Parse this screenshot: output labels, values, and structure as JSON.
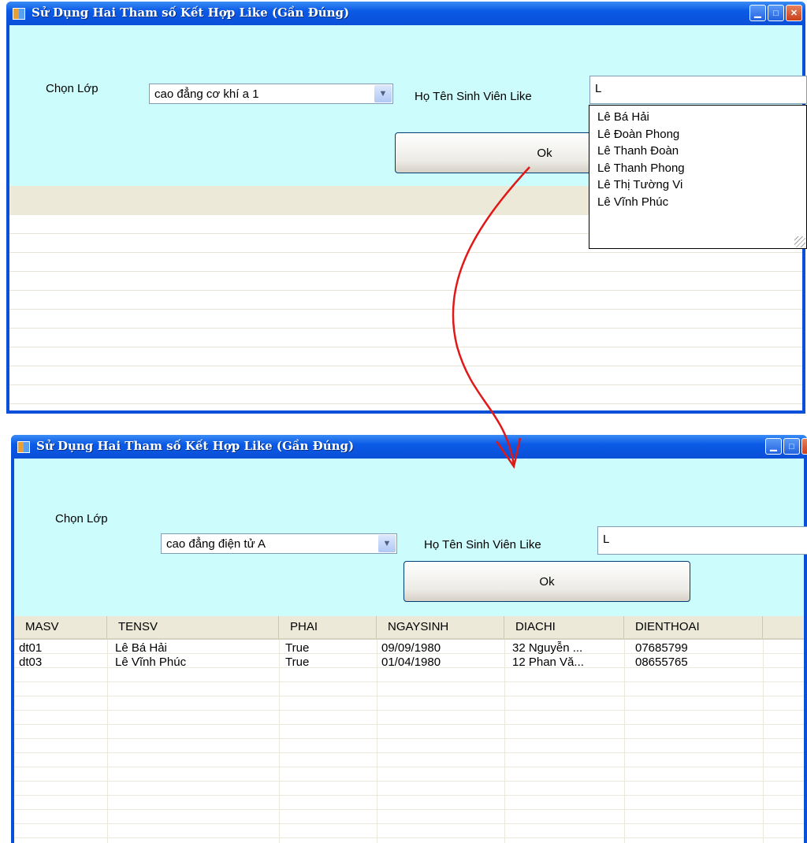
{
  "window1": {
    "title": "Sử Dụng Hai Tham số Kết Hợp Like (Gần Đúng)",
    "class_label": "Chọn Lớp",
    "class_value": "cao đẳng cơ khí a 1",
    "name_label": "Họ Tên Sinh Viên Like",
    "name_value": "L",
    "ok_label": "Ok",
    "suggestions": [
      "Lê Bá Hải",
      "Lê Đoàn Phong",
      "Lê Thanh Đoàn",
      "Lê Thanh Phong",
      "Lê Thị Tường Vi",
      "Lê Vĩnh Phúc"
    ]
  },
  "window2": {
    "title": "Sử Dụng Hai Tham số Kết Hợp Like (Gần Đúng)",
    "class_label": "Chọn Lớp",
    "class_value": "cao đẳng điện tử A",
    "name_label": "Họ Tên Sinh Viên Like",
    "name_value": "L",
    "ok_label": "Ok",
    "columns": [
      "MASV",
      "TENSV",
      "PHAI",
      "NGAYSINH",
      "DIACHI",
      "DIENTHOAI"
    ],
    "rows": [
      [
        "dt01",
        "Lê Bá Hải",
        "True",
        "09/09/1980",
        "32 Nguyễn ...",
        "07685799"
      ],
      [
        "dt03",
        "Lê Vĩnh Phúc",
        "True",
        "01/04/1980",
        "12 Phan Vă...",
        "08655765"
      ]
    ]
  },
  "colors": {
    "titlebar": "#0a4fd8",
    "client_bg": "#ccfcfc",
    "arrow": "#e01818"
  },
  "icons": {
    "window_icon": "app-window-icon",
    "minimize": "minimize-icon",
    "maximize": "maximize-icon",
    "close": "close-icon",
    "combo_arrow": "chevron-down-icon"
  }
}
